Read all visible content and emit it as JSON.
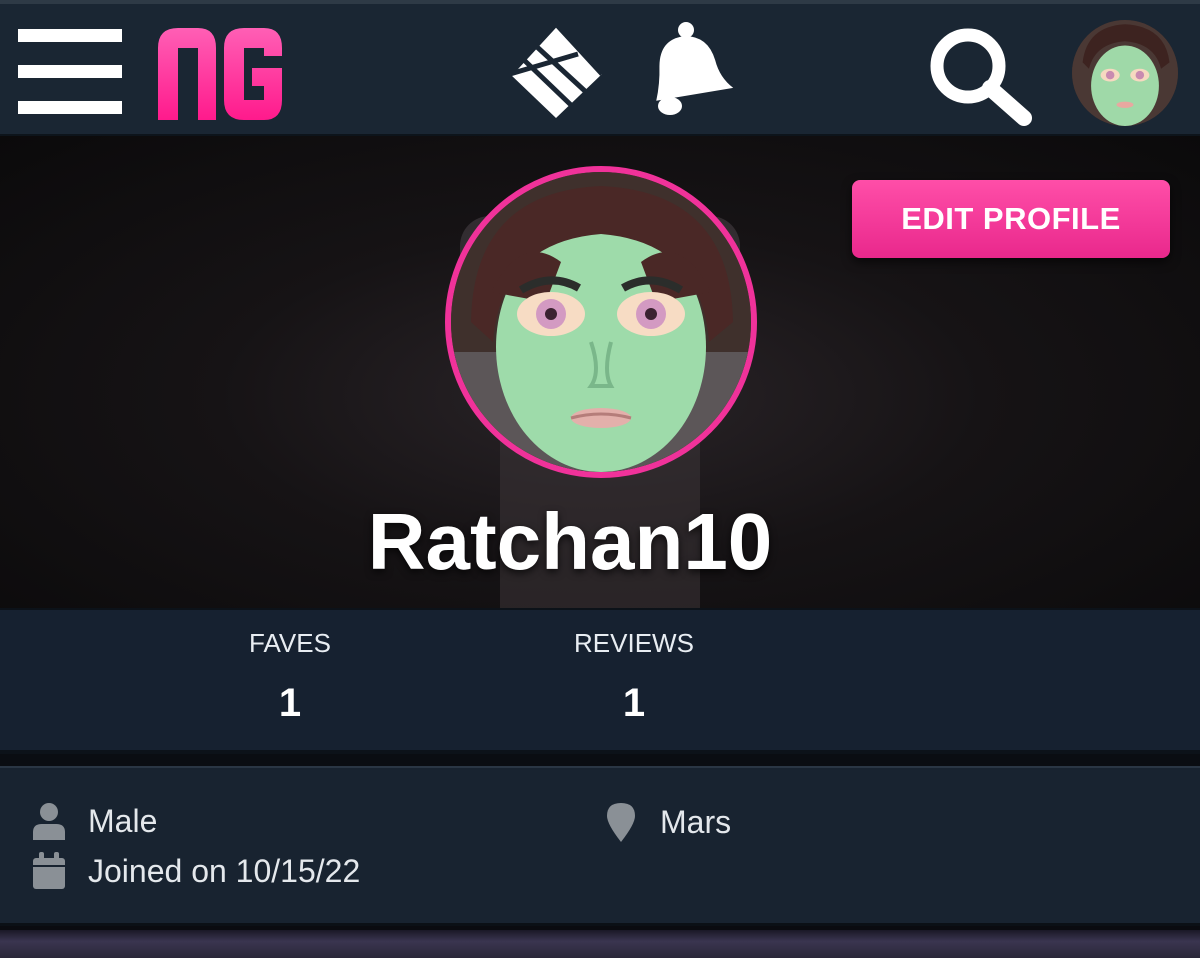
{
  "app": {
    "logo_text": "NG",
    "accent_color": "#f0329a",
    "header_bg": "#1a2633"
  },
  "topbar": {
    "menu_icon": "hamburger-menu-icon",
    "inbox_icon": "envelope-icon",
    "notifications_icon": "bell-icon",
    "search_icon": "search-icon",
    "avatar_icon": "user-avatar"
  },
  "profile": {
    "username": "Ratchan10",
    "edit_button_label": "EDIT PROFILE"
  },
  "stats": [
    {
      "label": "FAVES",
      "value": "1"
    },
    {
      "label": "REVIEWS",
      "value": "1"
    }
  ],
  "info": {
    "gender": "Male",
    "joined": "Joined on 10/15/22",
    "location": "Mars",
    "gender_icon": "person-icon",
    "joined_icon": "calendar-icon",
    "location_icon": "map-pin-icon"
  }
}
